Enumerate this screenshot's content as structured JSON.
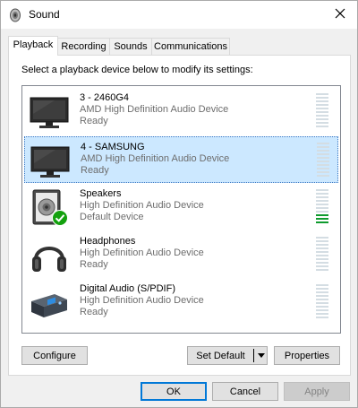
{
  "window": {
    "title": "Sound",
    "close_icon": "close-icon",
    "app_icon": "speaker-icon"
  },
  "tabs": [
    {
      "label": "Playback",
      "active": true
    },
    {
      "label": "Recording",
      "active": false
    },
    {
      "label": "Sounds",
      "active": false
    },
    {
      "label": "Communications",
      "active": false
    }
  ],
  "playback": {
    "instructions": "Select a playback device below to modify its settings:",
    "devices": [
      {
        "name": "3 - 2460G4",
        "description": "AMD High Definition Audio Device",
        "status": "Ready",
        "icon": "monitor-icon",
        "selected": false,
        "level_bars_on": 0
      },
      {
        "name": "4 - SAMSUNG",
        "description": "AMD High Definition Audio Device",
        "status": "Ready",
        "icon": "monitor-icon",
        "selected": true,
        "level_bars_on": 0
      },
      {
        "name": "Speakers",
        "description": "High Definition Audio Device",
        "status": "Default Device",
        "icon": "speaker-icon",
        "badge": "default-check-icon",
        "selected": false,
        "level_bars_on": 3
      },
      {
        "name": "Headphones",
        "description": "High Definition Audio Device",
        "status": "Ready",
        "icon": "headphones-icon",
        "selected": false,
        "level_bars_on": 0
      },
      {
        "name": "Digital Audio (S/PDIF)",
        "description": "High Definition Audio Device",
        "status": "Ready",
        "icon": "digital-audio-icon",
        "selected": false,
        "level_bars_on": 0
      }
    ],
    "meter_bar_count": 10,
    "buttons": {
      "configure": "Configure",
      "set_default": "Set Default",
      "properties": "Properties"
    }
  },
  "footer": {
    "ok": "OK",
    "cancel": "Cancel",
    "apply": "Apply"
  },
  "colors": {
    "selection": "#cce8ff",
    "meter_on": "#0f9b2e",
    "meter_off": "#d4dde3",
    "default_badge": "#13a10e"
  }
}
